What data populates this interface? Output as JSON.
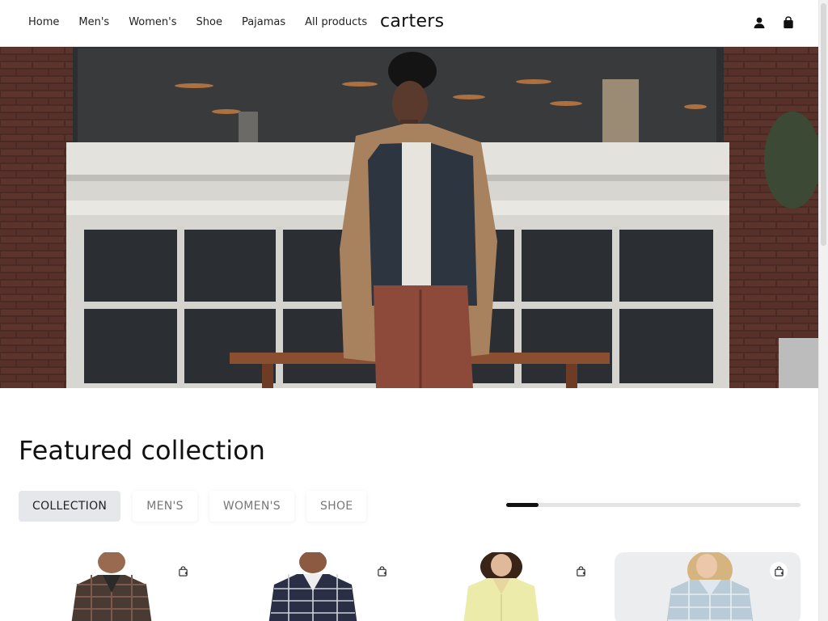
{
  "header": {
    "nav": [
      {
        "label": "Home",
        "name": "nav-home"
      },
      {
        "label": "Men's",
        "name": "nav-mens"
      },
      {
        "label": "Women's",
        "name": "nav-womens"
      },
      {
        "label": "Shoe",
        "name": "nav-shoe"
      },
      {
        "label": "Pajamas",
        "name": "nav-pajamas"
      },
      {
        "label": "All products",
        "name": "nav-all-products"
      }
    ],
    "brand": "carters",
    "icons": {
      "account": "user-icon",
      "cart": "shopping-bag-icon"
    }
  },
  "hero": {
    "image": "man-in-camel-coat-in-front-of-shop-window"
  },
  "featured": {
    "title": "Featured collection",
    "tabs": [
      "COLLECTION",
      "MEN'S",
      "WOMEN'S",
      "SHOE"
    ],
    "active_tab": "COLLECTION",
    "slider_progress": 0.11
  },
  "products": [
    {
      "image": "man-plaid-flannel-pajama-shirt",
      "cart_icon": "add-to-cart-icon"
    },
    {
      "image": "man-navy-plaid-pajama-shirt",
      "cart_icon": "add-to-cart-icon"
    },
    {
      "image": "woman-yellow-pajama-shirt",
      "cart_icon": "add-to-cart-icon"
    },
    {
      "image": "woman-light-blue-plaid-pajamas",
      "cart_icon": "add-to-cart-icon"
    }
  ],
  "colors": {
    "accent": "#111111",
    "active_tab_bg": "#e6e7ea",
    "hero_brick": "#4a2a24"
  }
}
